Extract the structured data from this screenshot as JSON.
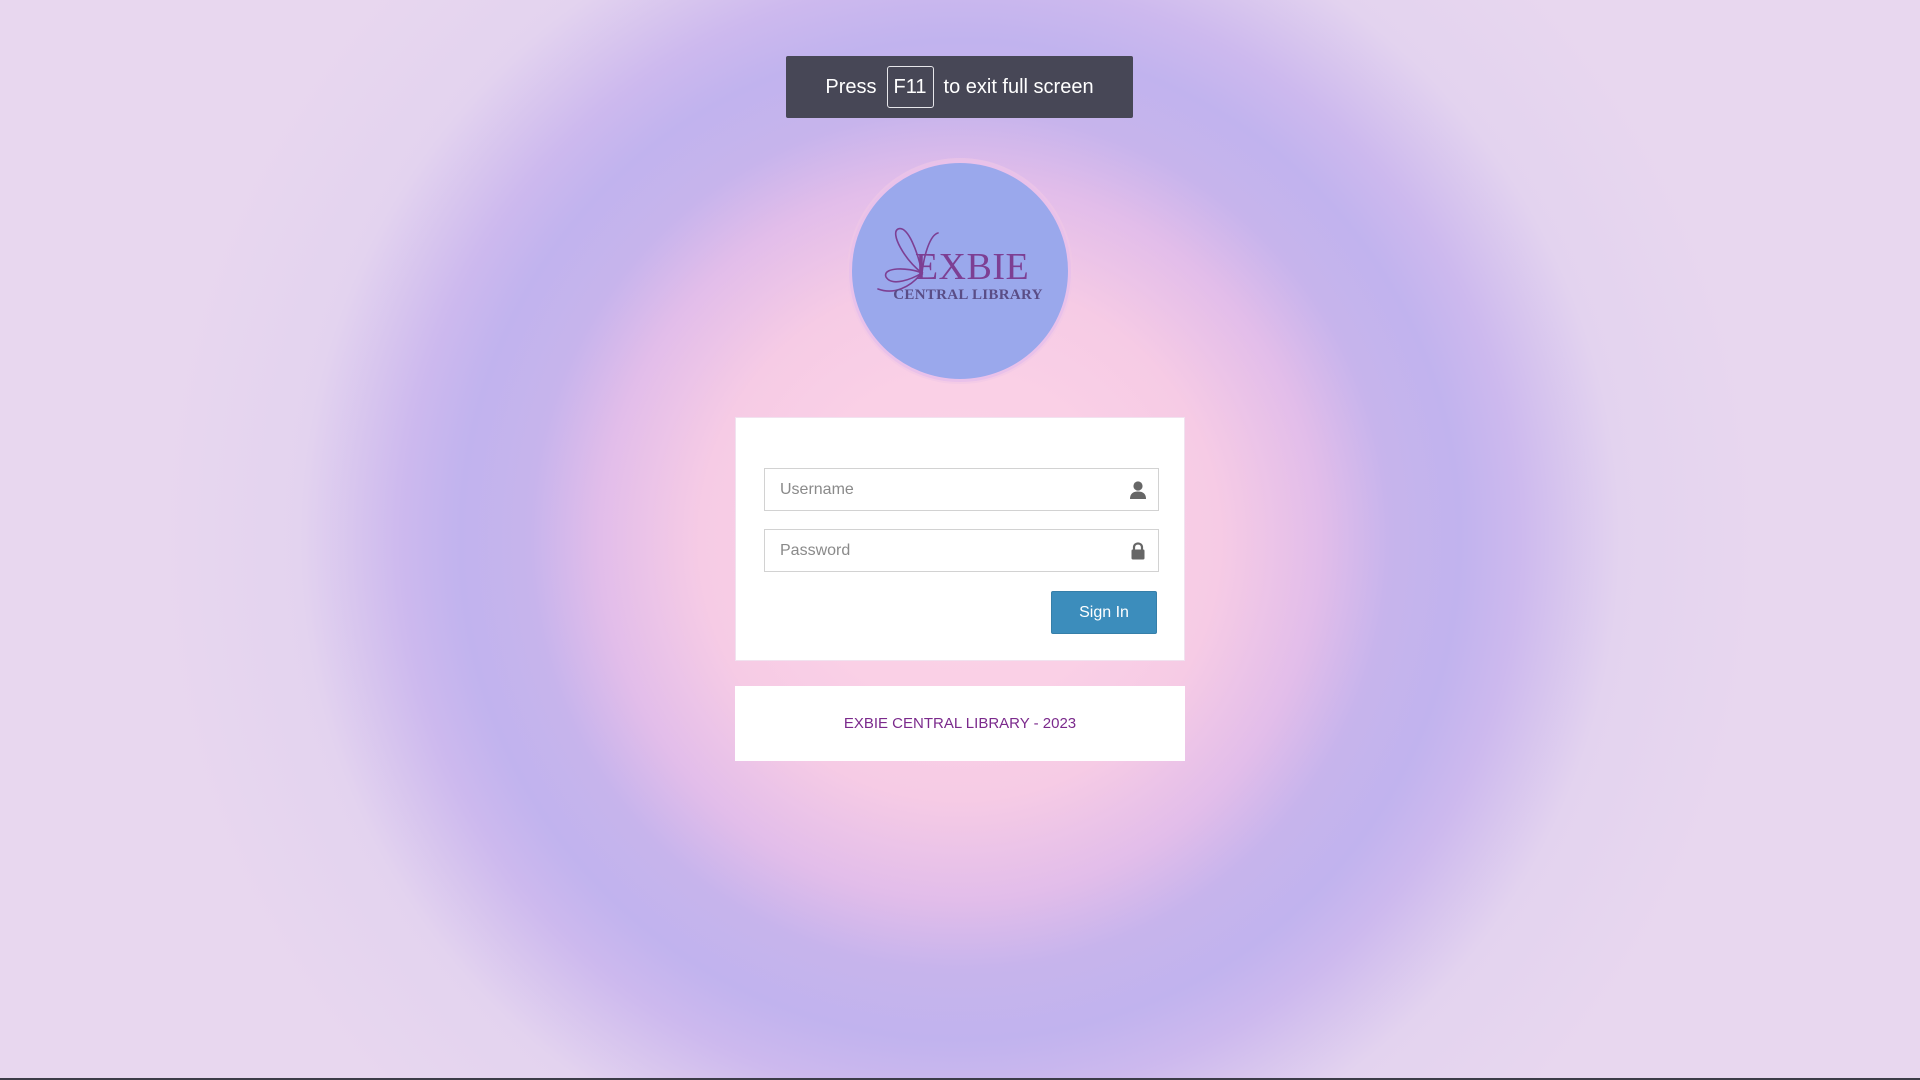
{
  "fullscreen_notice": {
    "prefix": "Press",
    "key": "F11",
    "suffix": "to exit full screen"
  },
  "logo": {
    "brand": "EXBIE",
    "subtitle": "CENTRAL LIBRARY",
    "icon": "butterfly-icon"
  },
  "login": {
    "username_placeholder": "Username",
    "username_value": "",
    "password_placeholder": "Password",
    "password_value": "",
    "username_icon": "user-icon",
    "password_icon": "lock-icon",
    "signin_label": "Sign In"
  },
  "footer": {
    "text": "EXBIE CENTRAL LIBRARY - 2023"
  },
  "colors": {
    "primary_button": "#3c8dbc",
    "footer_text": "#7b2a8c",
    "logo_circle": "#9aa8ec",
    "notice_bg": "#474756"
  }
}
